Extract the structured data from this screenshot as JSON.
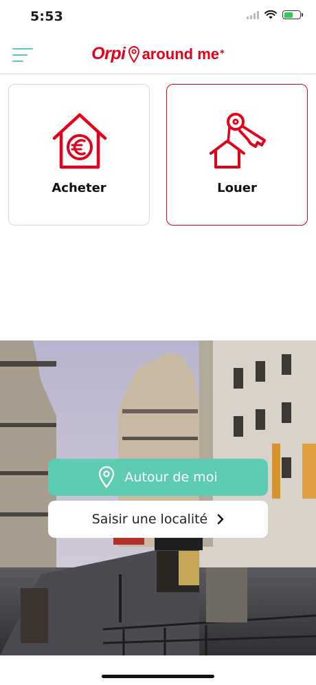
{
  "status_bar": {
    "time": "5:53",
    "battery_level": 0.55,
    "icons": [
      "signal-icon",
      "wifi-icon",
      "battery-charging-icon"
    ]
  },
  "header": {
    "logo_brand": "Orpi",
    "logo_tagline": "around me",
    "logo_mark": "*",
    "icons": [
      "menu-icon",
      "location-pin-icon"
    ]
  },
  "cards": [
    {
      "label": "Acheter",
      "icon": "house-euro-icon",
      "selected": false
    },
    {
      "label": "Louer",
      "icon": "house-keys-icon",
      "selected": true
    }
  ],
  "actions": {
    "around_me_label": "Autour de moi",
    "around_me_icon": "location-pin-icon",
    "enter_location_label": "Saisir une localité",
    "enter_location_icon": "chevron-right-icon"
  },
  "colors": {
    "brand_red": "#e2001a",
    "accent_teal": "#5ecbb3",
    "menu_teal": "#4fcfb3"
  }
}
